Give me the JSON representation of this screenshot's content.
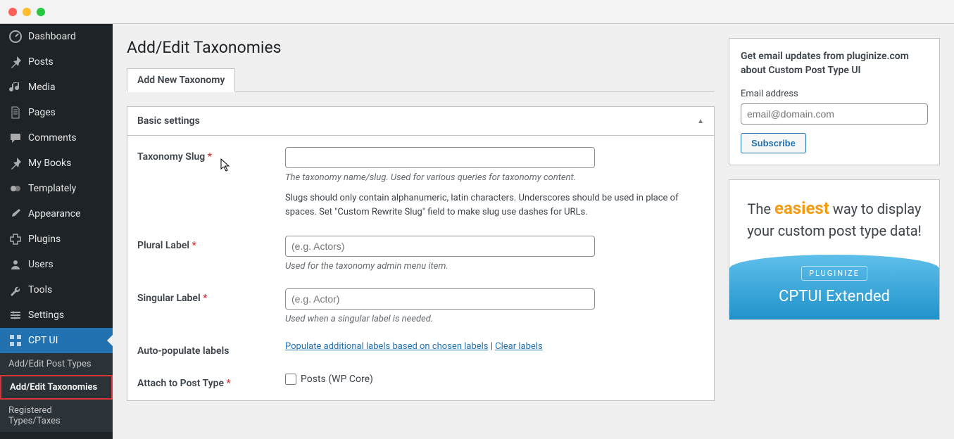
{
  "sidebar": {
    "items": [
      {
        "icon": "dashboard",
        "label": "Dashboard"
      },
      {
        "icon": "pin",
        "label": "Posts"
      },
      {
        "icon": "media",
        "label": "Media"
      },
      {
        "icon": "page",
        "label": "Pages"
      },
      {
        "icon": "comment",
        "label": "Comments"
      },
      {
        "icon": "pin",
        "label": "My Books"
      },
      {
        "icon": "templately",
        "label": "Templately"
      },
      {
        "icon": "brush",
        "label": "Appearance"
      },
      {
        "icon": "plugin",
        "label": "Plugins"
      },
      {
        "icon": "user",
        "label": "Users"
      },
      {
        "icon": "wrench",
        "label": "Tools"
      },
      {
        "icon": "settings",
        "label": "Settings"
      },
      {
        "icon": "cptui",
        "label": "CPT UI"
      }
    ],
    "sub": [
      "Add/Edit Post Types",
      "Add/Edit Taxonomies",
      "Registered Types/Taxes"
    ]
  },
  "page": {
    "title": "Add/Edit Taxonomies",
    "tab": "Add New Taxonomy",
    "panel_title": "Basic settings",
    "fields": {
      "slug_label": "Taxonomy Slug",
      "slug_desc": "The taxonomy name/slug. Used for various queries for taxonomy content.",
      "slug_help": "Slugs should only contain alphanumeric, latin characters. Underscores should be used in place of spaces. Set \"Custom Rewrite Slug\" field to make slug use dashes for URLs.",
      "plural_label": "Plural Label",
      "plural_placeholder": "(e.g. Actors)",
      "plural_desc": "Used for the taxonomy admin menu item.",
      "singular_label": "Singular Label",
      "singular_placeholder": "(e.g. Actor)",
      "singular_desc": "Used when a singular label is needed.",
      "auto_label": "Auto-populate labels",
      "auto_link1": "Populate additional labels based on chosen labels",
      "auto_link2": "Clear labels",
      "attach_label": "Attach to Post Type",
      "attach_option": "Posts (WP Core)"
    }
  },
  "sidecard": {
    "title": "Get email updates from pluginize.com about Custom Post Type UI",
    "email_label": "Email address",
    "email_placeholder": "email@domain.com",
    "subscribe": "Subscribe"
  },
  "promo": {
    "line1_pre": "The ",
    "line1_hl": "easiest",
    "line1_post": " way to display your custom post type data!",
    "brand": "PLUGINIZE",
    "title": "CPTUI Extended"
  },
  "required_marker": "*",
  "separator": " | "
}
